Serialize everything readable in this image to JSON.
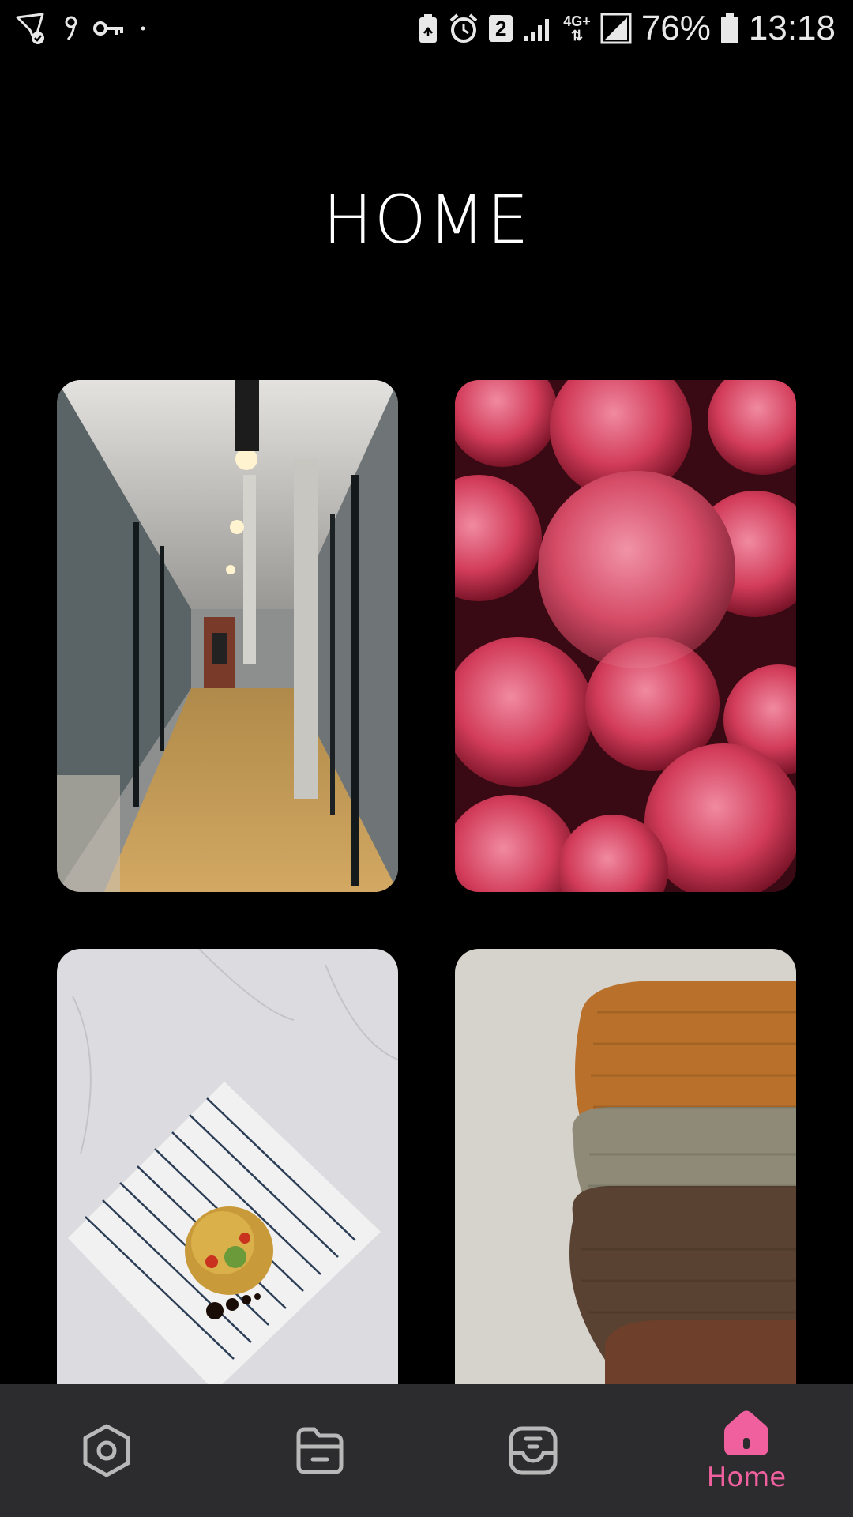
{
  "status_bar": {
    "battery_percent": "76%",
    "time": "13:18",
    "sim_badge": "2",
    "network_type": "4G+"
  },
  "page": {
    "title": "HOME"
  },
  "cards": [
    {
      "subject": "office hallway photo"
    },
    {
      "subject": "frozen raspberries photo"
    },
    {
      "subject": "food on striped plate photo"
    },
    {
      "subject": "stacked knit sweaters photo"
    }
  ],
  "bottom_nav": {
    "items": [
      {
        "icon": "settings-hexagon-icon",
        "label": ""
      },
      {
        "icon": "folder-icon",
        "label": ""
      },
      {
        "icon": "inbox-icon",
        "label": ""
      },
      {
        "icon": "home-icon",
        "label": "Home"
      }
    ],
    "active_color": "#f0609e",
    "inactive_color": "#b8b8b8",
    "background": "#2c2c2e"
  }
}
